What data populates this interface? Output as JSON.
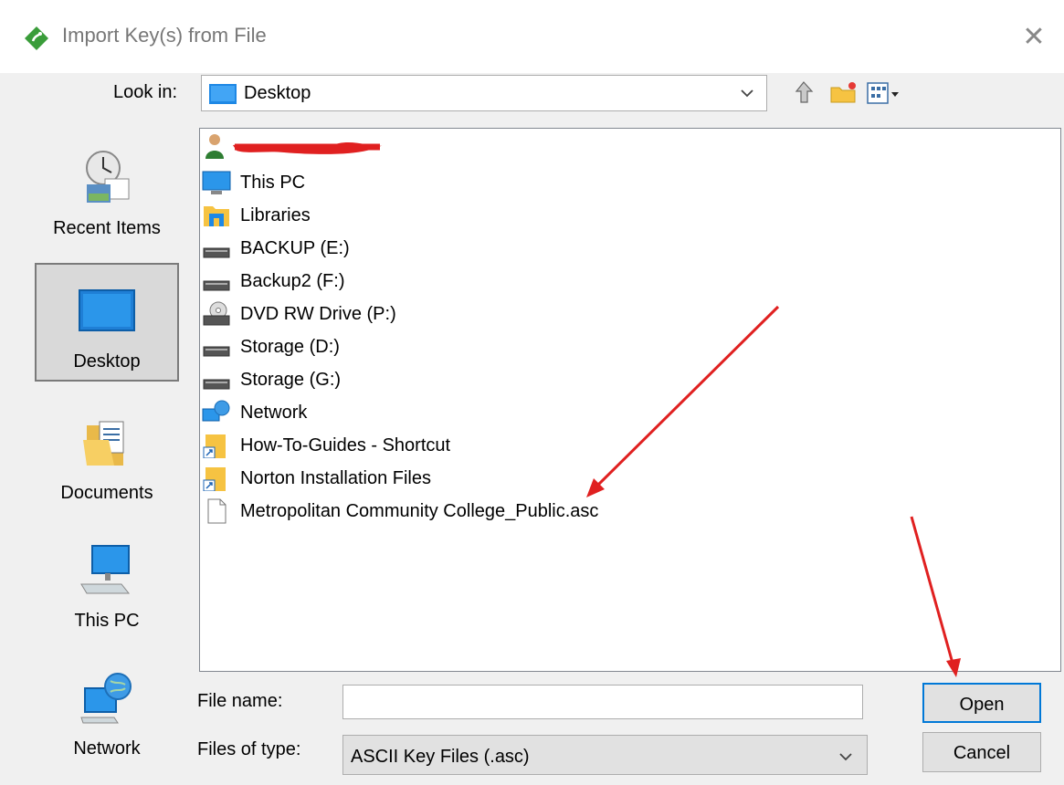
{
  "window": {
    "title": "Import Key(s) from File",
    "close_glyph": "✕"
  },
  "toolbar": {
    "look_in_label": "Look in:",
    "look_in_value": "Desktop"
  },
  "places": [
    {
      "label": "Recent Items",
      "icon": "recent-items-icon"
    },
    {
      "label": "Desktop",
      "icon": "desktop-icon",
      "selected": true
    },
    {
      "label": "Documents",
      "icon": "documents-icon"
    },
    {
      "label": "This PC",
      "icon": "this-pc-icon"
    },
    {
      "label": "Network",
      "icon": "network-icon"
    }
  ],
  "files": [
    {
      "name": "",
      "icon": "user-icon",
      "redacted": true
    },
    {
      "name": "This PC",
      "icon": "monitor-icon"
    },
    {
      "name": "Libraries",
      "icon": "libraries-icon"
    },
    {
      "name": "BACKUP (E:)",
      "icon": "drive-icon"
    },
    {
      "name": "Backup2 (F:)",
      "icon": "drive-icon"
    },
    {
      "name": "DVD RW Drive (P:)",
      "icon": "dvd-drive-icon"
    },
    {
      "name": "Storage (D:)",
      "icon": "drive-icon"
    },
    {
      "name": "Storage (G:)",
      "icon": "drive-icon"
    },
    {
      "name": "Network",
      "icon": "network-icon"
    },
    {
      "name": "How-To-Guides - Shortcut",
      "icon": "folder-shortcut-icon"
    },
    {
      "name": "Norton Installation Files",
      "icon": "folder-shortcut-icon"
    },
    {
      "name": "Metropolitan Community College_Public.asc",
      "icon": "file-icon"
    }
  ],
  "bottom": {
    "file_name_label": "File name:",
    "file_name_value": "",
    "files_of_type_label": "Files of type:",
    "files_of_type_value": "ASCII Key Files (.asc)",
    "open_label": "Open",
    "cancel_label": "Cancel"
  },
  "colors": {
    "accent": "#0078d7",
    "annotation_arrow": "#e02020"
  }
}
